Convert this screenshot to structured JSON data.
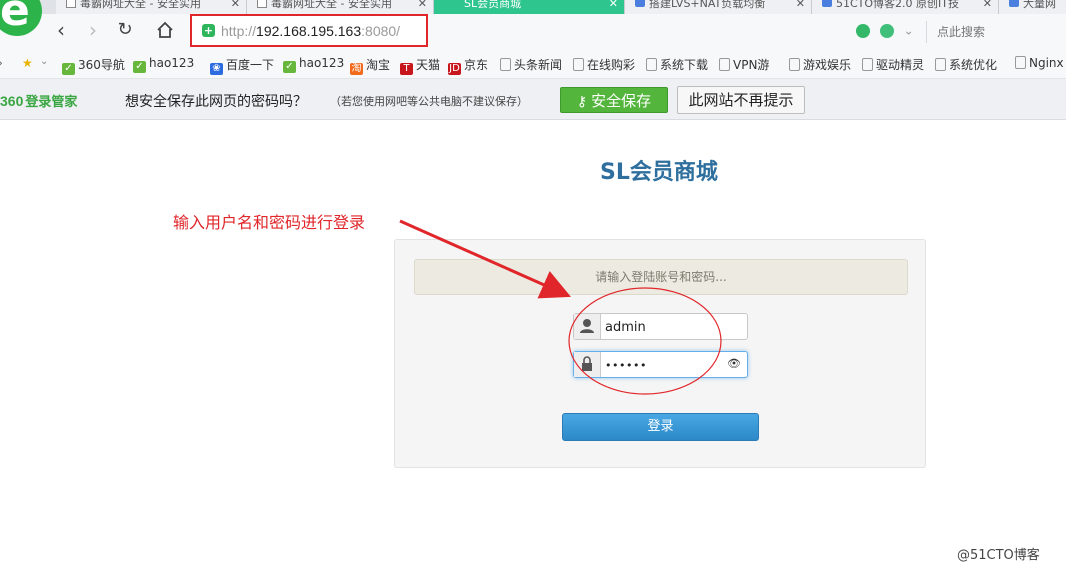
{
  "tabs": [
    {
      "title": "毒霸网址大全 - 安全实用"
    },
    {
      "title": "毒霸网址大全 - 安全实用"
    },
    {
      "title": "SL会员商城"
    },
    {
      "title": "搭建LVS+NAT负载均衡"
    },
    {
      "title": "51CTO博客2.0 原创IT技"
    },
    {
      "title": "大量网"
    }
  ],
  "address": {
    "scheme": "http://",
    "host": "192.168.195.163",
    "port_path": ":8080/"
  },
  "search": {
    "placeholder": "点此搜索"
  },
  "bookmarks": [
    {
      "label": "360导航",
      "icon": "hao-icon"
    },
    {
      "label": "hao123",
      "icon": "hao-icon"
    },
    {
      "label": "百度一下",
      "icon": "baidu-icon"
    },
    {
      "label": "hao123",
      "icon": "hao-icon"
    },
    {
      "label": "淘宝",
      "icon": "taobao-icon"
    },
    {
      "label": "天猫",
      "icon": "tmall-icon"
    },
    {
      "label": "京东",
      "icon": "jd-icon"
    },
    {
      "label": "头条新闻",
      "icon": "page-icon"
    },
    {
      "label": "在线购彩",
      "icon": "page-icon"
    },
    {
      "label": "系统下载",
      "icon": "page-icon"
    },
    {
      "label": "VPN游",
      "icon": "page-icon"
    },
    {
      "label": "游戏娱乐",
      "icon": "page-icon"
    },
    {
      "label": "驱动精灵",
      "icon": "page-icon"
    },
    {
      "label": "系统优化",
      "icon": "page-icon"
    },
    {
      "label": "Nginx",
      "icon": "page-icon"
    }
  ],
  "pwbar": {
    "logo_num": "360",
    "logo_text": "登录管家",
    "question": "想安全保存此网页的密码吗？",
    "note": "（若您使用网吧等公共电脑不建议保存）",
    "save_label": "安全保存",
    "never_label": "此网站不再提示"
  },
  "page": {
    "title": "SL会员商城",
    "alert": "请输入登陆账号和密码...",
    "username_value": "admin",
    "password_value": "••••••",
    "login_label": "登录"
  },
  "annotation": {
    "text": "输入用户名和密码进行登录",
    "color": "#e0262a"
  },
  "watermark": "@51CTO博客",
  "colors": {
    "accent_green": "#2fc58f",
    "title_blue": "#2e6f9e",
    "login_blue": "#2c88c8",
    "annotation_red": "#e0262a"
  }
}
